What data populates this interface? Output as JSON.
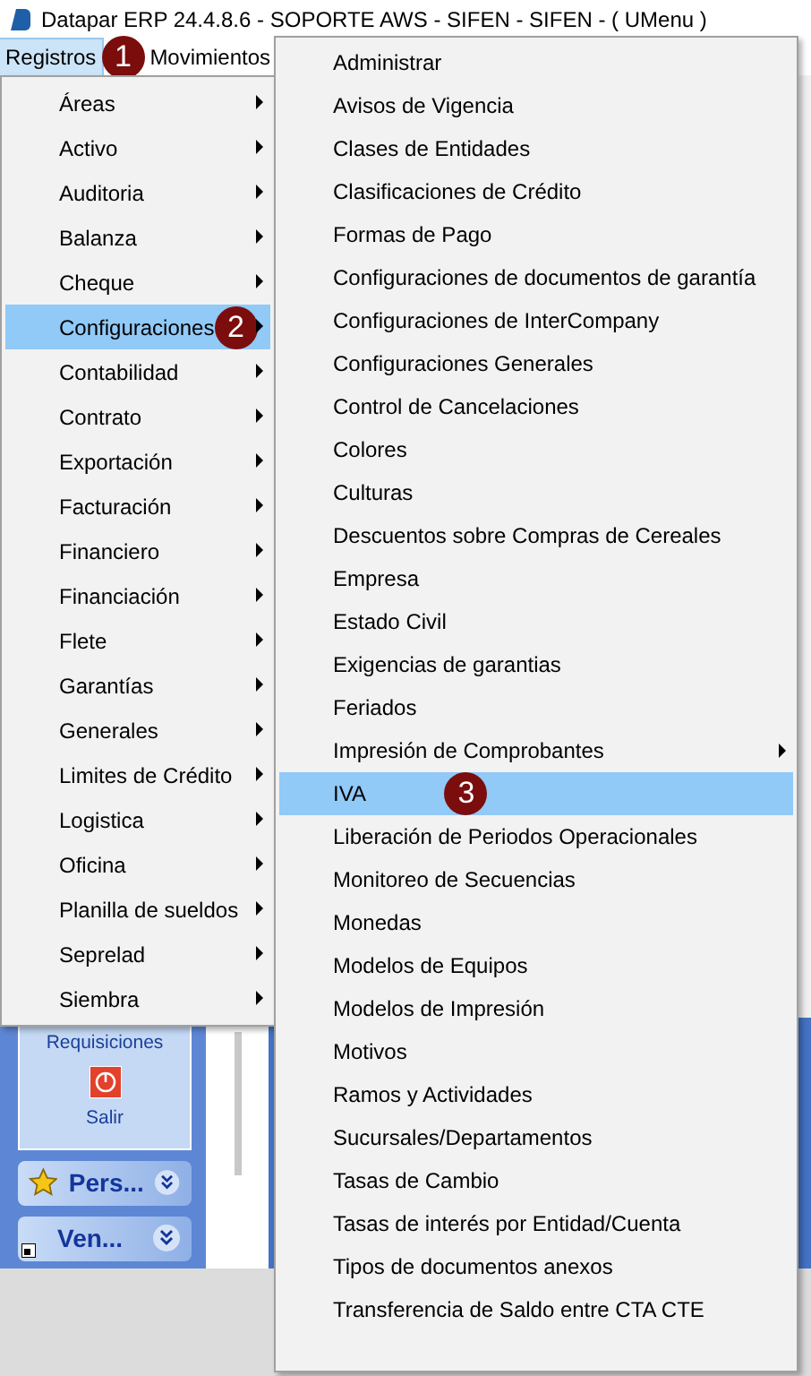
{
  "window": {
    "title": "Datapar ERP 24.4.8.6 - SOPORTE AWS - SIFEN - SIFEN - ( UMenu )"
  },
  "menu_bar": [
    {
      "label": "Registros",
      "selected": true,
      "badge": "1"
    },
    {
      "label": "Movimientos",
      "selected": false
    }
  ],
  "menu": [
    {
      "label": "Áreas",
      "has_submenu": true,
      "selected": false
    },
    {
      "label": "Activo",
      "has_submenu": true,
      "selected": false
    },
    {
      "label": "Auditoria",
      "has_submenu": true,
      "selected": false
    },
    {
      "label": "Balanza",
      "has_submenu": true,
      "selected": false
    },
    {
      "label": "Cheque",
      "has_submenu": true,
      "selected": false
    },
    {
      "label": "Configuraciones",
      "has_submenu": true,
      "selected": true,
      "badge": "2"
    },
    {
      "label": "Contabilidad",
      "has_submenu": true,
      "selected": false
    },
    {
      "label": "Contrato",
      "has_submenu": true,
      "selected": false
    },
    {
      "label": "Exportación",
      "has_submenu": true,
      "selected": false
    },
    {
      "label": "Facturación",
      "has_submenu": true,
      "selected": false
    },
    {
      "label": "Financiero",
      "has_submenu": true,
      "selected": false
    },
    {
      "label": "Financiación",
      "has_submenu": true,
      "selected": false
    },
    {
      "label": "Flete",
      "has_submenu": true,
      "selected": false
    },
    {
      "label": "Garantías",
      "has_submenu": true,
      "selected": false
    },
    {
      "label": "Generales",
      "has_submenu": true,
      "selected": false
    },
    {
      "label": "Limites de Crédito",
      "has_submenu": true,
      "selected": false
    },
    {
      "label": "Logistica",
      "has_submenu": true,
      "selected": false
    },
    {
      "label": "Oficina",
      "has_submenu": true,
      "selected": false
    },
    {
      "label": "Planilla de sueldos",
      "has_submenu": true,
      "selected": false
    },
    {
      "label": "Seprelad",
      "has_submenu": true,
      "selected": false
    },
    {
      "label": "Siembra",
      "has_submenu": true,
      "selected": false
    }
  ],
  "submenu": [
    {
      "label": "Administrar",
      "has_submenu": false,
      "selected": false
    },
    {
      "label": "Avisos de Vigencia",
      "has_submenu": false,
      "selected": false
    },
    {
      "label": "Clases de Entidades",
      "has_submenu": false,
      "selected": false
    },
    {
      "label": "Clasificaciones de Crédito",
      "has_submenu": false,
      "selected": false
    },
    {
      "label": "Formas de Pago",
      "has_submenu": false,
      "selected": false
    },
    {
      "label": "Configuraciones de documentos de garantía",
      "has_submenu": false,
      "selected": false
    },
    {
      "label": "Configuraciones de InterCompany",
      "has_submenu": false,
      "selected": false
    },
    {
      "label": "Configuraciones Generales",
      "has_submenu": false,
      "selected": false
    },
    {
      "label": "Control de Cancelaciones",
      "has_submenu": false,
      "selected": false
    },
    {
      "label": "Colores",
      "has_submenu": false,
      "selected": false
    },
    {
      "label": "Culturas",
      "has_submenu": false,
      "selected": false
    },
    {
      "label": "Descuentos sobre Compras de Cereales",
      "has_submenu": false,
      "selected": false
    },
    {
      "label": "Empresa",
      "has_submenu": false,
      "selected": false
    },
    {
      "label": "Estado Civil",
      "has_submenu": false,
      "selected": false
    },
    {
      "label": "Exigencias de garantias",
      "has_submenu": false,
      "selected": false
    },
    {
      "label": "Feriados",
      "has_submenu": false,
      "selected": false
    },
    {
      "label": "Impresión de Comprobantes",
      "has_submenu": true,
      "selected": false
    },
    {
      "label": "IVA",
      "has_submenu": false,
      "selected": true,
      "badge": "3"
    },
    {
      "label": "Liberación de Periodos Operacionales",
      "has_submenu": false,
      "selected": false
    },
    {
      "label": "Monitoreo de Secuencias",
      "has_submenu": false,
      "selected": false
    },
    {
      "label": "Monedas",
      "has_submenu": false,
      "selected": false
    },
    {
      "label": "Modelos de Equipos",
      "has_submenu": false,
      "selected": false
    },
    {
      "label": "Modelos de Impresión",
      "has_submenu": false,
      "selected": false
    },
    {
      "label": "Motivos",
      "has_submenu": false,
      "selected": false
    },
    {
      "label": "Ramos y Actividades",
      "has_submenu": false,
      "selected": false
    },
    {
      "label": "Sucursales/Departamentos",
      "has_submenu": false,
      "selected": false
    },
    {
      "label": "Tasas de Cambio",
      "has_submenu": false,
      "selected": false
    },
    {
      "label": "Tasas de interés por Entidad/Cuenta",
      "has_submenu": false,
      "selected": false
    },
    {
      "label": "Tipos de documentos anexos",
      "has_submenu": false,
      "selected": false
    },
    {
      "label": "Transferencia de Saldo entre CTA CTE",
      "has_submenu": false,
      "selected": false
    }
  ],
  "sidebar": {
    "links": [
      {
        "label": "Requisiciones",
        "kind": "text"
      },
      {
        "label": "Salir",
        "kind": "power"
      }
    ],
    "panels": [
      {
        "label": "Pers...",
        "kind": "star"
      },
      {
        "label": "Ven...",
        "kind": "plain"
      }
    ]
  }
}
